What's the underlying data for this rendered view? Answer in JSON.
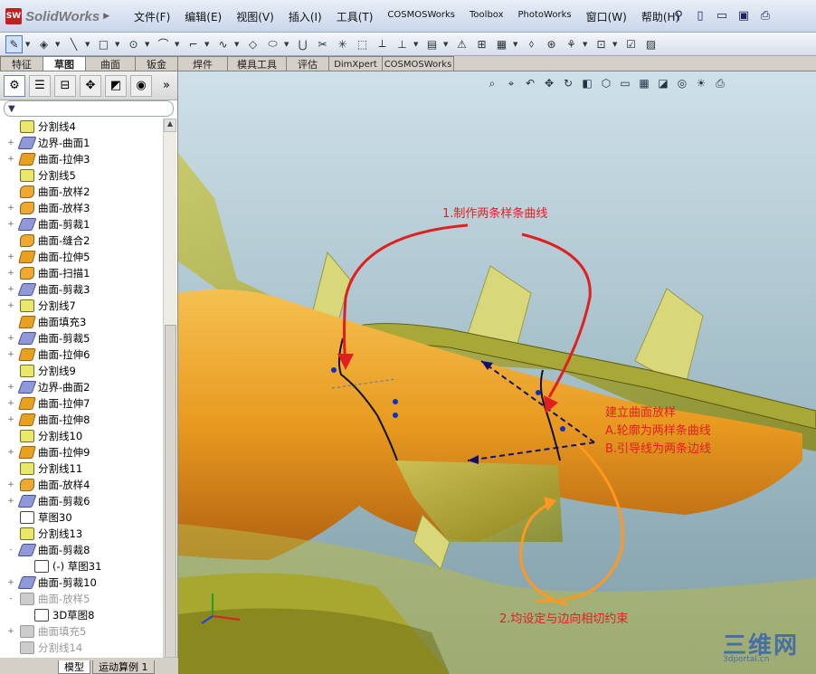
{
  "app": {
    "logo_badge": "SW",
    "name": "SolidWorks"
  },
  "menu": [
    "文件(F)",
    "编辑(E)",
    "视图(V)",
    "插入(I)",
    "工具(T)",
    "COSMOSWorks",
    "Toolbox",
    "PhotoWorks",
    "窗口(W)",
    "帮助(H)"
  ],
  "command_tabs": [
    "特征",
    "草图",
    "曲面",
    "钣金",
    "焊件",
    "模具工具",
    "评估",
    "DimXpert",
    "COSMOSWorks"
  ],
  "active_command_tab": "草图",
  "tree": [
    {
      "label": "分割线4",
      "icon": "split",
      "exp": ""
    },
    {
      "label": "边界-曲面1",
      "icon": "trim",
      "exp": "+"
    },
    {
      "label": "曲面-拉伸3",
      "icon": "surf",
      "exp": "+"
    },
    {
      "label": "分割线5",
      "icon": "split",
      "exp": ""
    },
    {
      "label": "曲面-放样2",
      "icon": "loft",
      "exp": ""
    },
    {
      "label": "曲面-放样3",
      "icon": "loft",
      "exp": "+"
    },
    {
      "label": "曲面-剪裁1",
      "icon": "trim",
      "exp": "+"
    },
    {
      "label": "曲面-缝合2",
      "icon": "loft",
      "exp": ""
    },
    {
      "label": "曲面-拉伸5",
      "icon": "surf",
      "exp": "+"
    },
    {
      "label": "曲面-扫描1",
      "icon": "loft",
      "exp": "+"
    },
    {
      "label": "曲面-剪裁3",
      "icon": "trim",
      "exp": "+"
    },
    {
      "label": "分割线7",
      "icon": "split",
      "exp": "+"
    },
    {
      "label": "曲面填充3",
      "icon": "surf",
      "exp": ""
    },
    {
      "label": "曲面-剪裁5",
      "icon": "trim",
      "exp": "+"
    },
    {
      "label": "曲面-拉伸6",
      "icon": "surf",
      "exp": "+"
    },
    {
      "label": "分割线9",
      "icon": "split",
      "exp": ""
    },
    {
      "label": "边界-曲面2",
      "icon": "trim",
      "exp": "+"
    },
    {
      "label": "曲面-拉伸7",
      "icon": "surf",
      "exp": "+"
    },
    {
      "label": "曲面-拉伸8",
      "icon": "surf",
      "exp": "+"
    },
    {
      "label": "分割线10",
      "icon": "split",
      "exp": ""
    },
    {
      "label": "曲面-拉伸9",
      "icon": "surf",
      "exp": "+"
    },
    {
      "label": "分割线11",
      "icon": "split",
      "exp": ""
    },
    {
      "label": "曲面-放样4",
      "icon": "loft",
      "exp": "+"
    },
    {
      "label": "曲面-剪裁6",
      "icon": "trim",
      "exp": "+"
    },
    {
      "label": "草图30",
      "icon": "sketch",
      "exp": ""
    },
    {
      "label": "分割线13",
      "icon": "split",
      "exp": ""
    },
    {
      "label": "曲面-剪裁8",
      "icon": "trim",
      "exp": "-"
    },
    {
      "label": "(-) 草图31",
      "icon": "sketch",
      "exp": "",
      "sub": true
    },
    {
      "label": "曲面-剪裁10",
      "icon": "trim",
      "exp": "+"
    },
    {
      "label": "曲面-放样5",
      "icon": "gray",
      "exp": "-",
      "dim": true
    },
    {
      "label": "3D草图8",
      "icon": "sketch",
      "exp": "",
      "sub": true
    },
    {
      "label": "曲面填充5",
      "icon": "gray",
      "exp": "+",
      "dim": true
    },
    {
      "label": "分割线14",
      "icon": "gray",
      "exp": "",
      "dim": true
    }
  ],
  "bottom_tabs": [
    "模型",
    "运动算例 1"
  ],
  "active_bottom_tab": "模型",
  "annotations": {
    "a1": "1.制作两条样条曲线",
    "a2_title": "建立曲面放样",
    "a2_line1": "A.轮廓为两样条曲线",
    "a2_line2": "B.引导线为两条边线",
    "a3": "2.均设定与边向相切约束"
  },
  "watermark": {
    "big": "三维网",
    "small": "3dportal.cn"
  },
  "colors": {
    "annotation": "#e02020",
    "surface": "#e8a020",
    "green_surface": "#b8b848",
    "background_top": "#cfe0e8"
  }
}
